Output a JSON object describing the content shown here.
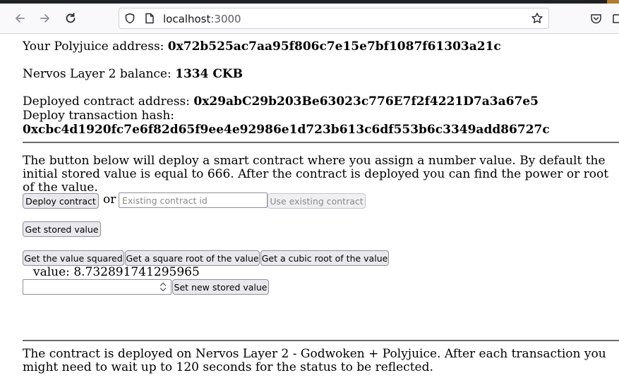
{
  "browser": {
    "url_host": "localhost",
    "url_port": ":3000"
  },
  "account": {
    "address_label": "Your Polyjuice address: ",
    "address_value": "0x72b525ac7aa95f806c7e15e7bf1087f61303a21c",
    "balance_label": "Nervos Layer 2 balance: ",
    "balance_value": "1334 CKB"
  },
  "contract": {
    "deployed_label": "Deployed contract address: ",
    "deployed_value": "0x29abC29b203Be63023c776E7f2f4221D7a3a67e5",
    "tx_label": "Deploy transaction hash:",
    "tx_value": "0xcbc4d1920fc7e6f82d65f9ee4e92986e1d723b613c6df553b6c3349add86727c"
  },
  "intro_text": "The button below will deploy a smart contract where you assign a number value. By default the initial stored value is equal to 666. After the contract is deployed you can find the power or root of the value.",
  "actions": {
    "deploy_label": "Deploy contract",
    "or_text": "or",
    "existing_placeholder": "Existing contract id",
    "use_existing_label": "Use existing contract",
    "get_stored_label": "Get stored value",
    "squared_label": "Get the value squared",
    "square_root_label": "Get a square root of the value",
    "cubic_root_label": "Get a cubic root of the value",
    "value_text": "value: 8.732891741295965",
    "set_new_label": "Set new stored value"
  },
  "footer_text": "The contract is deployed on Nervos Layer 2 - Godwoken + Polyjuice. After each transaction you might need to wait up to 120 seconds for the status to be reflected."
}
